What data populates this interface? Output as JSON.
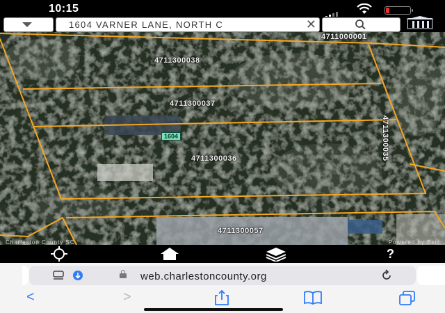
{
  "status": {
    "time": "10:15"
  },
  "search": {
    "address": "1604 VARNER LANE, NORTH C",
    "clear_glyph": "✕"
  },
  "map": {
    "parcels": [
      {
        "id": "4711000001"
      },
      {
        "id": "4711300038"
      },
      {
        "id": "4711300037"
      },
      {
        "id": "4711300036"
      },
      {
        "id": "4711300057"
      },
      {
        "id": "4711300035"
      }
    ],
    "address_tag": "1604",
    "attribution_left": "Charleston County SC",
    "attribution_right": "Powered by Esri",
    "parcel_line_color": "#f5a623"
  },
  "toolbar": {
    "help_glyph": "?"
  },
  "browser": {
    "url": "web.charlestoncounty.org",
    "back_glyph": "<",
    "forward_glyph": ">"
  }
}
